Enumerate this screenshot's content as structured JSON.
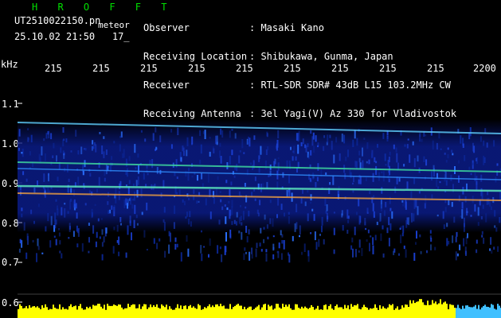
{
  "header": {
    "title": "H R O F F T",
    "filename_prefix": "UT2510022150.pn",
    "filename_suffix": "meteor",
    "date_time": "25.10.02 21:50",
    "count": "17_"
  },
  "info": [
    {
      "label": "Observer",
      "value": ": Masaki Kano"
    },
    {
      "label": "Receiving Location",
      "value": ": Shibukawa, Gunma, Japan"
    },
    {
      "label": "Receiver",
      "value": ": RTL-SDR SDR# 43dB L15 103.2MHz CW"
    },
    {
      "label": "Receiving Antenna",
      "value": ": 3el Yagi(V) Az 330 for Vladivostok"
    }
  ],
  "axes": {
    "y_unit": "kHz",
    "y_ticks": [
      "1.1",
      "1.0",
      "0.9",
      "0.8",
      "0.7",
      "0.6"
    ],
    "x_ticks": [
      "215",
      "215",
      "215",
      "215",
      "215",
      "215",
      "215",
      "215",
      "215",
      "2200"
    ]
  },
  "colors": {
    "background": "#000000",
    "title": "#00e000",
    "text": "#ffffff",
    "amplitude": "#ffff00",
    "waterfall_base": "#0a1a80",
    "echo_line": "#60d0ff"
  }
}
